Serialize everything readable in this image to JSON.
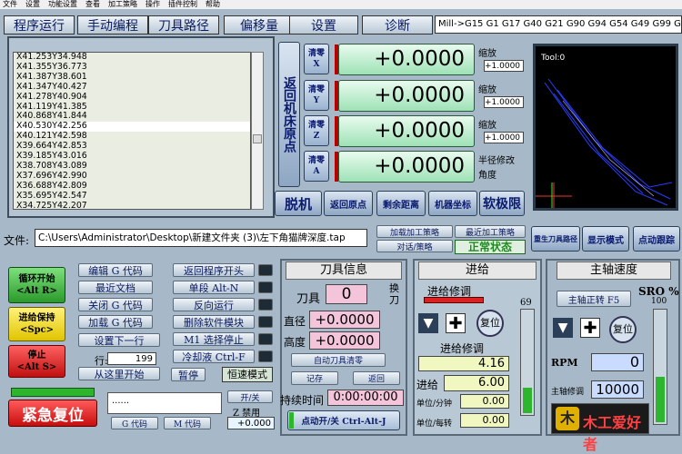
{
  "menu": [
    "文件",
    "设置",
    "功能设置",
    "查看",
    "加工策略",
    "操作",
    "插件控制",
    "帮助"
  ],
  "tabs": [
    "程序运行",
    "手动编程",
    "刀具路径",
    "偏移量",
    "设置",
    "诊断"
  ],
  "modal": "Mill->G15  G1 G17 G40 G21 G90 G94 G54 G49 G99 G6",
  "gcode_lines": [
    "X41.253Y34.948",
    "X41.355Y36.773",
    "X41.387Y38.601",
    "X41.347Y40.427",
    "X41.278Y40.904",
    "X41.119Y41.385",
    "X40.868Y41.844",
    "X40.530Y42.256",
    "X40.121Y42.598",
    "X39.664Y42.853",
    "X39.185Y43.016",
    "X38.708Y43.089",
    "X37.696Y42.990",
    "X36.688Y42.809",
    "X35.695Y42.547",
    "X34.725Y42.207"
  ],
  "gcode_selected": 7,
  "ref_home": "返回机床原点",
  "zero_labels": [
    "清零\nX",
    "清零\nY",
    "清零\nZ",
    "清零\nA"
  ],
  "dro_values": [
    "+0.0000",
    "+0.0000",
    "+0.0000",
    "+0.0000"
  ],
  "scale_label": "缩放",
  "scale_values": [
    "+1.0000",
    "+1.0000",
    "+1.0000"
  ],
  "radius_label": "半径修改",
  "angle_label": "角度",
  "dro_buttons": [
    "脱机",
    "返回原点",
    "剩余距离",
    "机器坐标",
    "软极限"
  ],
  "toolpath_label": "Tool:0",
  "file_label": "文件:",
  "file_path": "C:\\Users\\Administrator\\Desktop\\新建文件夹 (3)\\左下角猫牌深度.tap",
  "strategy": {
    "load": "加载加工策略",
    "recent": "最近加工策略",
    "dialog": "对话/策略",
    "status": "正常状态"
  },
  "view_btns": {
    "regen": "重生刀具路径",
    "display": "显示模式",
    "jog": "点动跟踪"
  },
  "cycle": {
    "start": "循环开始\n<Alt R>",
    "hold": "进给保持\n<Spc>",
    "stop": "停止\n<Alt S>"
  },
  "file_btns": [
    "编辑 G 代码",
    "最近文档",
    "关闭 G 代码",
    "加载 G 代码"
  ],
  "set_next": "设置下一行",
  "line_label": "行:",
  "line_val": "199",
  "run_from": "从这里开始",
  "mid_btns": [
    "返回程序开头",
    "单段 Alt-N",
    "反向运行",
    "删除软件模块",
    "M1 选择停止",
    "冷却液 Ctrl-F"
  ],
  "pause": "暂停",
  "const_vel": "恒速模式",
  "reset": "紧急复位",
  "dots": "......",
  "gcodes_btn": "G 代码",
  "mcodes_btn": "M 代码",
  "onoff": "开/关",
  "zinhibit": "Z 禁用",
  "zval": "+0.000",
  "tool": {
    "title": "刀具信息",
    "tool_lbl": "刀具",
    "tool_val": "0",
    "change": "换\n刀",
    "dia": "直径",
    "dia_val": "+0.0000",
    "height": "高度",
    "h_val": "+0.0000",
    "auto": "自动刀具清零",
    "remember": "记存",
    "return": "返回",
    "elapsed_lbl": "持续时间",
    "elapsed": "0:00:00:00",
    "jog": "点动开/关 Ctrl-Alt-J"
  },
  "feed": {
    "title": "进给",
    "override_lbl": "进给修调",
    "pct": "69",
    "reset": "复位",
    "ovr_lbl": "进给修调",
    "ovr_val": "4.16",
    "feed_lbl": "进给",
    "feed_val": "6.00",
    "upm_lbl": "单位/分钟",
    "upm_val": "0.00",
    "upr_lbl": "单位/每转",
    "upr_val": "0.00"
  },
  "spindle": {
    "title": "主轴速度",
    "sro": "SRO %",
    "sro_val": "100",
    "toggle": "主轴正转 F5",
    "reset": "复位",
    "rpm_lbl": "RPM",
    "rpm_val": "0",
    "ovr_lbl": "主轴修调",
    "ovr_val": "10000"
  },
  "logo": "木工爱好者",
  "colors": {
    "bg": "#a7b9c9",
    "dro": "#b8efc9",
    "red": "#d42020",
    "green": "#3ec33e"
  }
}
